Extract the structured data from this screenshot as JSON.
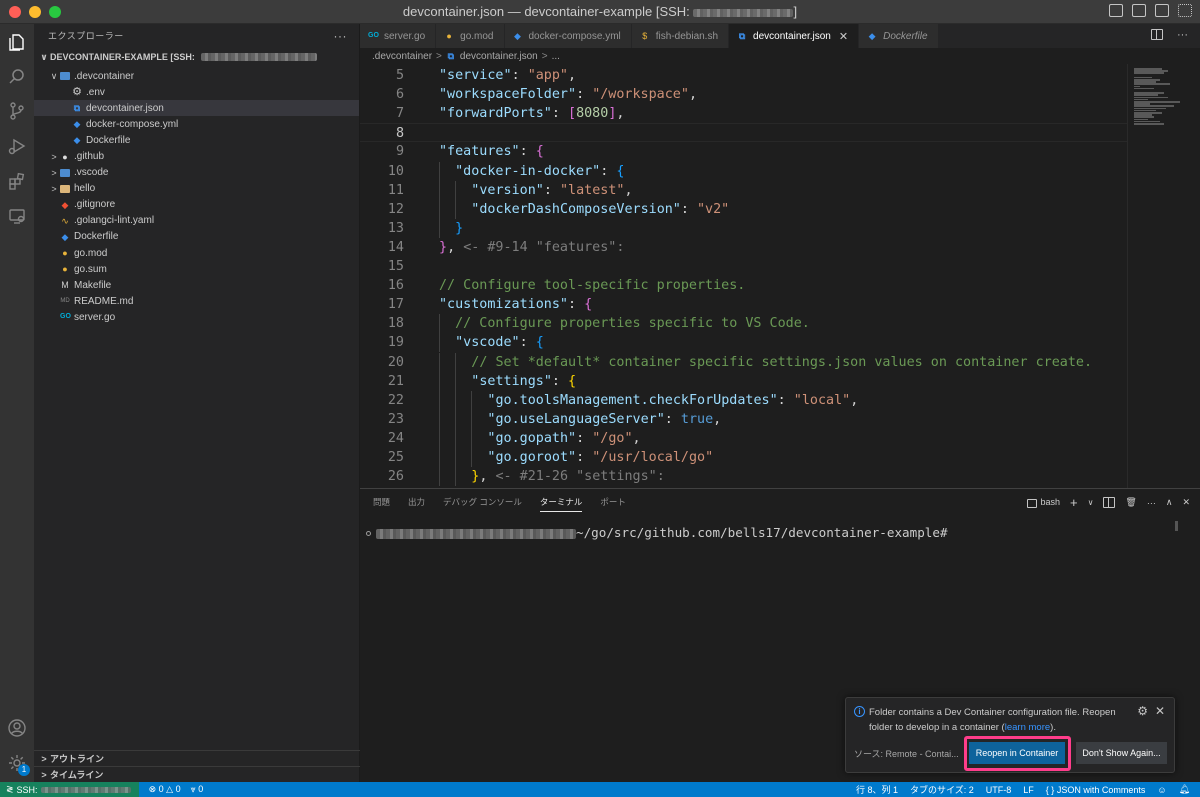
{
  "window": {
    "title_prefix": "devcontainer.json — devcontainer-example [SSH:",
    "title_suffix": "]"
  },
  "sidebar": {
    "header": "エクスプローラー",
    "section_title": "DEVCONTAINER-EXAMPLE [SSH:",
    "tree": [
      {
        "label": ".devcontainer",
        "icon": "folder-blue-icon",
        "chevron": "∨",
        "depth": 0,
        "selected": false
      },
      {
        "label": ".env",
        "icon": "gear-icon",
        "chevron": "",
        "depth": 1,
        "selected": false
      },
      {
        "label": "devcontainer.json",
        "icon": "vscode-icon",
        "chevron": "",
        "depth": 1,
        "selected": true
      },
      {
        "label": "docker-compose.yml",
        "icon": "docker-icon",
        "chevron": "",
        "depth": 1,
        "selected": false
      },
      {
        "label": "Dockerfile",
        "icon": "docker-icon",
        "chevron": "",
        "depth": 1,
        "selected": false
      },
      {
        "label": ".github",
        "icon": "github-folder-icon",
        "chevron": ">",
        "depth": 0,
        "selected": false
      },
      {
        "label": ".vscode",
        "icon": "folder-blue-icon",
        "chevron": ">",
        "depth": 0,
        "selected": false
      },
      {
        "label": "hello",
        "icon": "folder-icon",
        "chevron": ">",
        "depth": 0,
        "selected": false
      },
      {
        "label": ".gitignore",
        "icon": "git-icon",
        "chevron": "",
        "depth": 0,
        "selected": false
      },
      {
        "label": ".golangci-lint.yaml",
        "icon": "golangci-icon",
        "chevron": "",
        "depth": 0,
        "selected": false
      },
      {
        "label": "Dockerfile",
        "icon": "docker-icon",
        "chevron": "",
        "depth": 0,
        "selected": false
      },
      {
        "label": "go.mod",
        "icon": "gopher-icon",
        "chevron": "",
        "depth": 0,
        "selected": false
      },
      {
        "label": "go.sum",
        "icon": "gopher-icon",
        "chevron": "",
        "depth": 0,
        "selected": false
      },
      {
        "label": "Makefile",
        "icon": "makefile-icon",
        "chevron": "",
        "depth": 0,
        "selected": false
      },
      {
        "label": "README.md",
        "icon": "markdown-icon",
        "chevron": "",
        "depth": 0,
        "selected": false
      },
      {
        "label": "server.go",
        "icon": "go-file-icon",
        "chevron": "",
        "depth": 0,
        "selected": false
      }
    ],
    "outline": "アウトライン",
    "timeline": "タイムライン"
  },
  "activity": {
    "account_badge": "1"
  },
  "tabs": [
    {
      "label": "server.go",
      "icon": "go-file-icon",
      "active": false,
      "italic": false
    },
    {
      "label": "go.mod",
      "icon": "gopher-icon",
      "active": false,
      "italic": false
    },
    {
      "label": "docker-compose.yml",
      "icon": "docker-icon",
      "active": false,
      "italic": false
    },
    {
      "label": "fish-debian.sh",
      "icon": "shell-icon",
      "active": false,
      "italic": false
    },
    {
      "label": "devcontainer.json",
      "icon": "vscode-icon",
      "active": true,
      "italic": false
    },
    {
      "label": "Dockerfile",
      "icon": "docker-icon",
      "active": false,
      "italic": true
    }
  ],
  "breadcrumb": [
    ".devcontainer",
    "devcontainer.json",
    "..."
  ],
  "editor": {
    "current_line": 8,
    "lines": [
      {
        "n": "5",
        "indent": 1,
        "tokens": [
          [
            "k",
            "\"service\""
          ],
          [
            "p",
            ": "
          ],
          [
            "s",
            "\"app\""
          ],
          [
            "p",
            ","
          ]
        ]
      },
      {
        "n": "6",
        "indent": 1,
        "tokens": [
          [
            "k",
            "\"workspaceFolder\""
          ],
          [
            "p",
            ": "
          ],
          [
            "s",
            "\"/workspace\""
          ],
          [
            "p",
            ","
          ]
        ]
      },
      {
        "n": "7",
        "indent": 1,
        "tokens": [
          [
            "k",
            "\"forwardPorts\""
          ],
          [
            "p",
            ": "
          ],
          [
            "b2",
            "["
          ],
          [
            "n",
            "8080"
          ],
          [
            "b2",
            "]"
          ],
          [
            "p",
            ","
          ]
        ]
      },
      {
        "n": "8",
        "indent": 1,
        "tokens": []
      },
      {
        "n": "9",
        "indent": 1,
        "tokens": [
          [
            "k",
            "\"features\""
          ],
          [
            "p",
            ": "
          ],
          [
            "b2",
            "{"
          ]
        ]
      },
      {
        "n": "10",
        "indent": 2,
        "tokens": [
          [
            "k",
            "\"docker-in-docker\""
          ],
          [
            "p",
            ": "
          ],
          [
            "b3",
            "{"
          ]
        ]
      },
      {
        "n": "11",
        "indent": 3,
        "tokens": [
          [
            "k",
            "\"version\""
          ],
          [
            "p",
            ": "
          ],
          [
            "s",
            "\"latest\""
          ],
          [
            "p",
            ","
          ]
        ]
      },
      {
        "n": "12",
        "indent": 3,
        "tokens": [
          [
            "k",
            "\"dockerDashComposeVersion\""
          ],
          [
            "p",
            ": "
          ],
          [
            "s",
            "\"v2\""
          ]
        ]
      },
      {
        "n": "13",
        "indent": 2,
        "tokens": [
          [
            "b3",
            "}"
          ]
        ]
      },
      {
        "n": "14",
        "indent": 1,
        "tokens": [
          [
            "b2",
            "}"
          ],
          [
            "p",
            ", "
          ],
          [
            "ghost",
            "<- #9-14 \"features\":"
          ]
        ]
      },
      {
        "n": "15",
        "indent": 1,
        "tokens": []
      },
      {
        "n": "16",
        "indent": 1,
        "tokens": [
          [
            "c",
            "// Configure tool-specific properties."
          ]
        ]
      },
      {
        "n": "17",
        "indent": 1,
        "tokens": [
          [
            "k",
            "\"customizations\""
          ],
          [
            "p",
            ": "
          ],
          [
            "b2",
            "{"
          ]
        ]
      },
      {
        "n": "18",
        "indent": 2,
        "tokens": [
          [
            "c",
            "// Configure properties specific to VS Code."
          ]
        ]
      },
      {
        "n": "19",
        "indent": 2,
        "tokens": [
          [
            "k",
            "\"vscode\""
          ],
          [
            "p",
            ": "
          ],
          [
            "b3",
            "{"
          ]
        ]
      },
      {
        "n": "20",
        "indent": 3,
        "tokens": [
          [
            "c",
            "// Set *default* container specific settings.json values on container create."
          ]
        ]
      },
      {
        "n": "21",
        "indent": 3,
        "tokens": [
          [
            "k",
            "\"settings\""
          ],
          [
            "p",
            ": "
          ],
          [
            "b1",
            "{"
          ]
        ]
      },
      {
        "n": "22",
        "indent": 4,
        "tokens": [
          [
            "k",
            "\"go.toolsManagement.checkForUpdates\""
          ],
          [
            "p",
            ": "
          ],
          [
            "s",
            "\"local\""
          ],
          [
            "p",
            ","
          ]
        ]
      },
      {
        "n": "23",
        "indent": 4,
        "tokens": [
          [
            "k",
            "\"go.useLanguageServer\""
          ],
          [
            "p",
            ": "
          ],
          [
            "kw",
            "true"
          ],
          [
            "p",
            ","
          ]
        ]
      },
      {
        "n": "24",
        "indent": 4,
        "tokens": [
          [
            "k",
            "\"go.gopath\""
          ],
          [
            "p",
            ": "
          ],
          [
            "s",
            "\"/go\""
          ],
          [
            "p",
            ","
          ]
        ]
      },
      {
        "n": "25",
        "indent": 4,
        "tokens": [
          [
            "k",
            "\"go.goroot\""
          ],
          [
            "p",
            ": "
          ],
          [
            "s",
            "\"/usr/local/go\""
          ]
        ]
      },
      {
        "n": "26",
        "indent": 3,
        "tokens": [
          [
            "b1",
            "}"
          ],
          [
            "p",
            ", "
          ],
          [
            "ghost",
            "<- #21-26 \"settings\":"
          ]
        ]
      }
    ]
  },
  "panel": {
    "tabs": [
      {
        "label": "問題",
        "active": false
      },
      {
        "label": "出力",
        "active": false
      },
      {
        "label": "デバッグ コンソール",
        "active": false
      },
      {
        "label": "ターミナル",
        "active": true
      },
      {
        "label": "ポート",
        "active": false
      }
    ],
    "shell": "bash",
    "terminal_path": "~/go/src/github.com/bells17/devcontainer-example#"
  },
  "notification": {
    "message_main": "Folder contains a Dev Container configuration file. Reopen folder to develop in a container (",
    "link": "learn more",
    "message_end": ").",
    "source": "ソース: Remote - Contai...",
    "primary_button": "Reopen in Container",
    "secondary_button": "Don't Show Again...",
    "highlight_color": "#ff3d8b"
  },
  "status": {
    "remote_label": "SSH:",
    "errors": "0",
    "warnings": "0",
    "ports": "0",
    "cursor": "行 8、列 1",
    "tab_size": "タブのサイズ: 2",
    "encoding": "UTF-8",
    "eol": "LF",
    "language_braces": "{ }",
    "language": "JSON with Comments"
  }
}
